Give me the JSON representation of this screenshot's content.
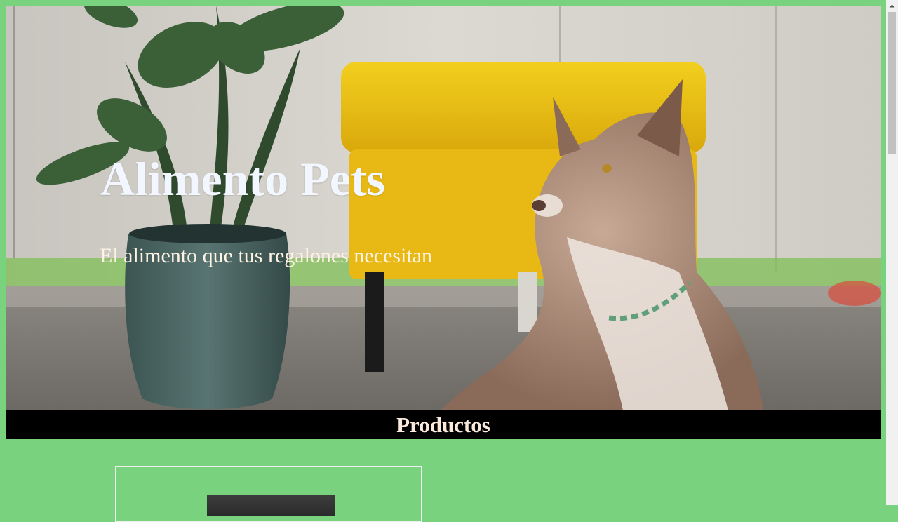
{
  "hero": {
    "title": "Alimento Pets",
    "subtitle": "El alimento que tus regalones necesitan",
    "image": "dog-with-plant-and-yellow-ottoman-photo"
  },
  "section": {
    "title": "Productos"
  },
  "products": [
    {
      "image": "product-image"
    }
  ],
  "colors": {
    "page_background": "#78d27e",
    "section_bar": "#000000",
    "title_text": "#f2f6ff",
    "subtitle_text": "#fff3e4"
  }
}
